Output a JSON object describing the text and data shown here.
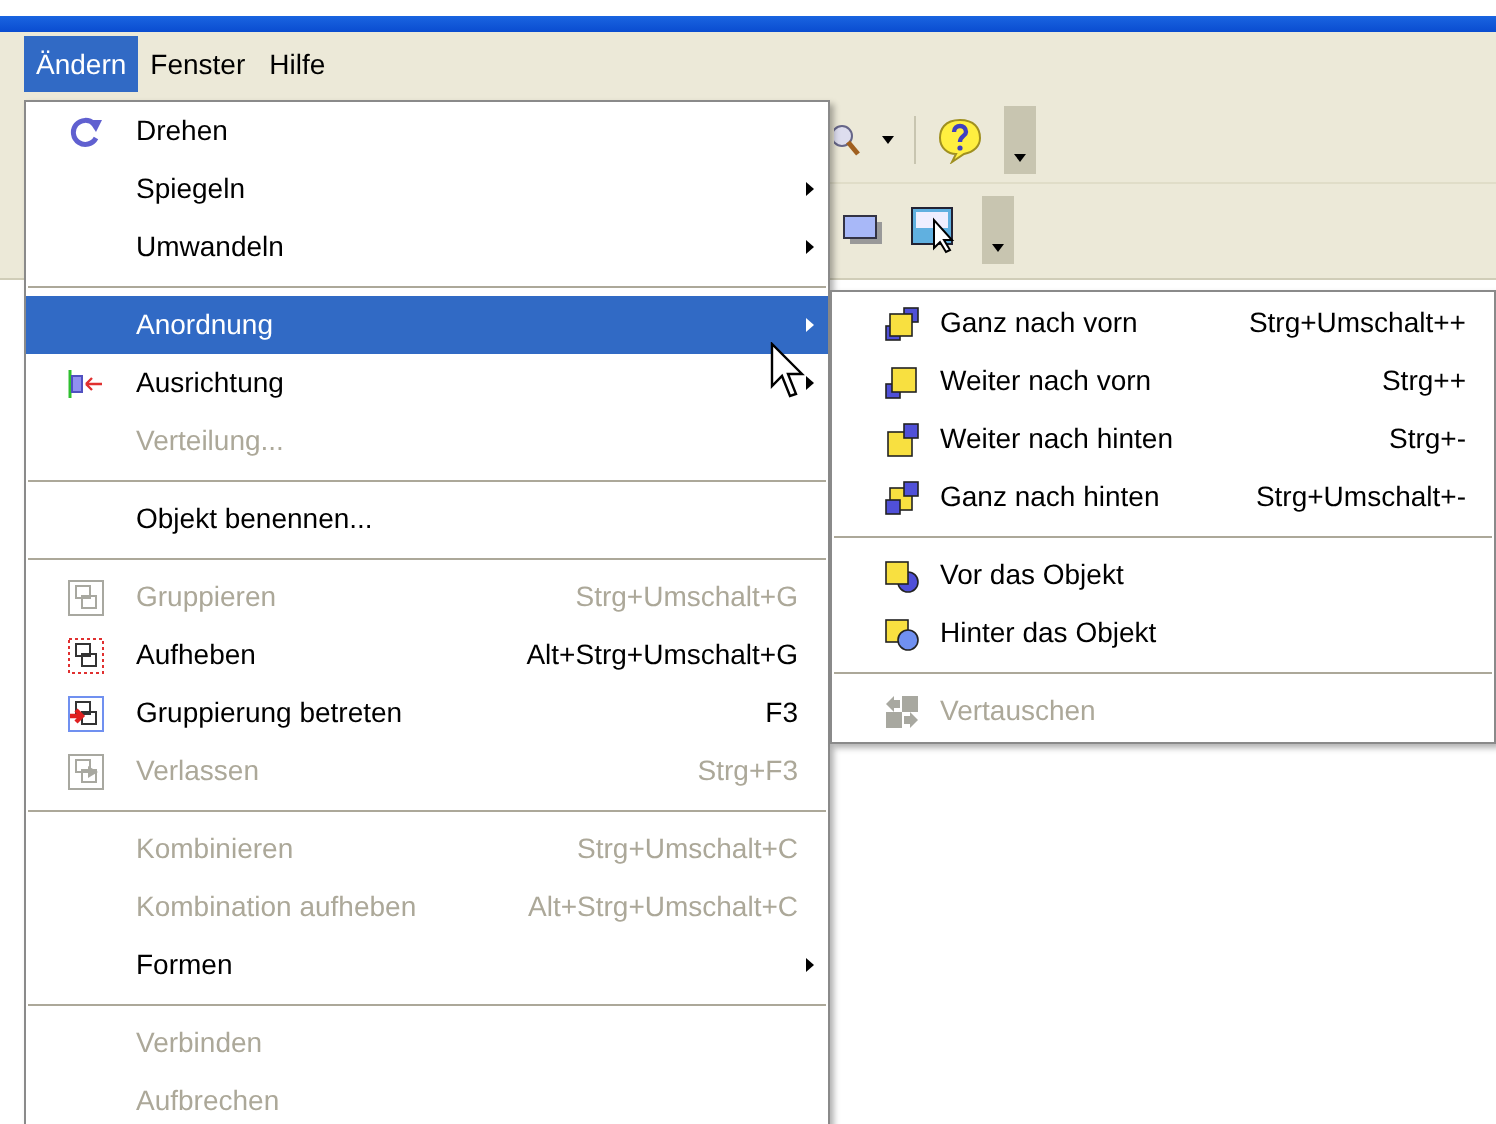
{
  "menubar": [
    {
      "label": "Ändern",
      "selected": true
    },
    {
      "label": "Fenster",
      "selected": false
    },
    {
      "label": "Hilfe",
      "selected": false
    }
  ],
  "menu": {
    "items": [
      {
        "kind": "item",
        "label": "Drehen",
        "disabled": false,
        "submenu": false,
        "selected": false
      },
      {
        "kind": "item",
        "label": "Spiegeln",
        "disabled": false,
        "submenu": true,
        "selected": false
      },
      {
        "kind": "item",
        "label": "Umwandeln",
        "disabled": false,
        "submenu": true,
        "selected": false
      },
      {
        "kind": "separator"
      },
      {
        "kind": "item",
        "label": "Anordnung",
        "disabled": false,
        "submenu": true,
        "selected": true
      },
      {
        "kind": "item",
        "label": "Ausrichtung",
        "disabled": false,
        "submenu": true,
        "selected": false
      },
      {
        "kind": "item",
        "label": "Verteilung...",
        "disabled": true,
        "submenu": false,
        "selected": false
      },
      {
        "kind": "separator"
      },
      {
        "kind": "item",
        "label": "Objekt benennen...",
        "disabled": false,
        "submenu": false,
        "selected": false
      },
      {
        "kind": "separator"
      },
      {
        "kind": "item",
        "label": "Gruppieren",
        "shortcut": "Strg+Umschalt+G",
        "disabled": true,
        "submenu": false,
        "selected": false
      },
      {
        "kind": "item",
        "label": "Aufheben",
        "shortcut": "Alt+Strg+Umschalt+G",
        "disabled": false,
        "submenu": false,
        "selected": false
      },
      {
        "kind": "item",
        "label": "Gruppierung betreten",
        "shortcut": "F3",
        "disabled": false,
        "submenu": false,
        "selected": false
      },
      {
        "kind": "item",
        "label": "Verlassen",
        "shortcut": "Strg+F3",
        "disabled": true,
        "submenu": false,
        "selected": false
      },
      {
        "kind": "separator"
      },
      {
        "kind": "item",
        "label": "Kombinieren",
        "shortcut": "Strg+Umschalt+C",
        "disabled": true,
        "submenu": false,
        "selected": false
      },
      {
        "kind": "item",
        "label": "Kombination aufheben",
        "shortcut": "Alt+Strg+Umschalt+C",
        "disabled": true,
        "submenu": false,
        "selected": false
      },
      {
        "kind": "item",
        "label": "Formen",
        "disabled": false,
        "submenu": true,
        "selected": false
      },
      {
        "kind": "separator"
      },
      {
        "kind": "item",
        "label": "Verbinden",
        "disabled": true,
        "submenu": false,
        "selected": false
      },
      {
        "kind": "item",
        "label": "Aufbrechen",
        "disabled": true,
        "submenu": false,
        "selected": false
      }
    ]
  },
  "submenu": {
    "items": [
      {
        "kind": "item",
        "label": "Ganz nach vorn",
        "shortcut": "Strg+Umschalt++",
        "disabled": false
      },
      {
        "kind": "item",
        "label": "Weiter nach vorn",
        "shortcut": "Strg++",
        "disabled": false
      },
      {
        "kind": "item",
        "label": "Weiter nach hinten",
        "shortcut": "Strg+-",
        "disabled": false
      },
      {
        "kind": "item",
        "label": "Ganz nach hinten",
        "shortcut": "Strg+Umschalt+-",
        "disabled": false
      },
      {
        "kind": "separator"
      },
      {
        "kind": "item",
        "label": "Vor das Objekt",
        "disabled": false
      },
      {
        "kind": "item",
        "label": "Hinter das Objekt",
        "disabled": false
      },
      {
        "kind": "separator"
      },
      {
        "kind": "item",
        "label": "Vertauschen",
        "disabled": true
      }
    ]
  }
}
